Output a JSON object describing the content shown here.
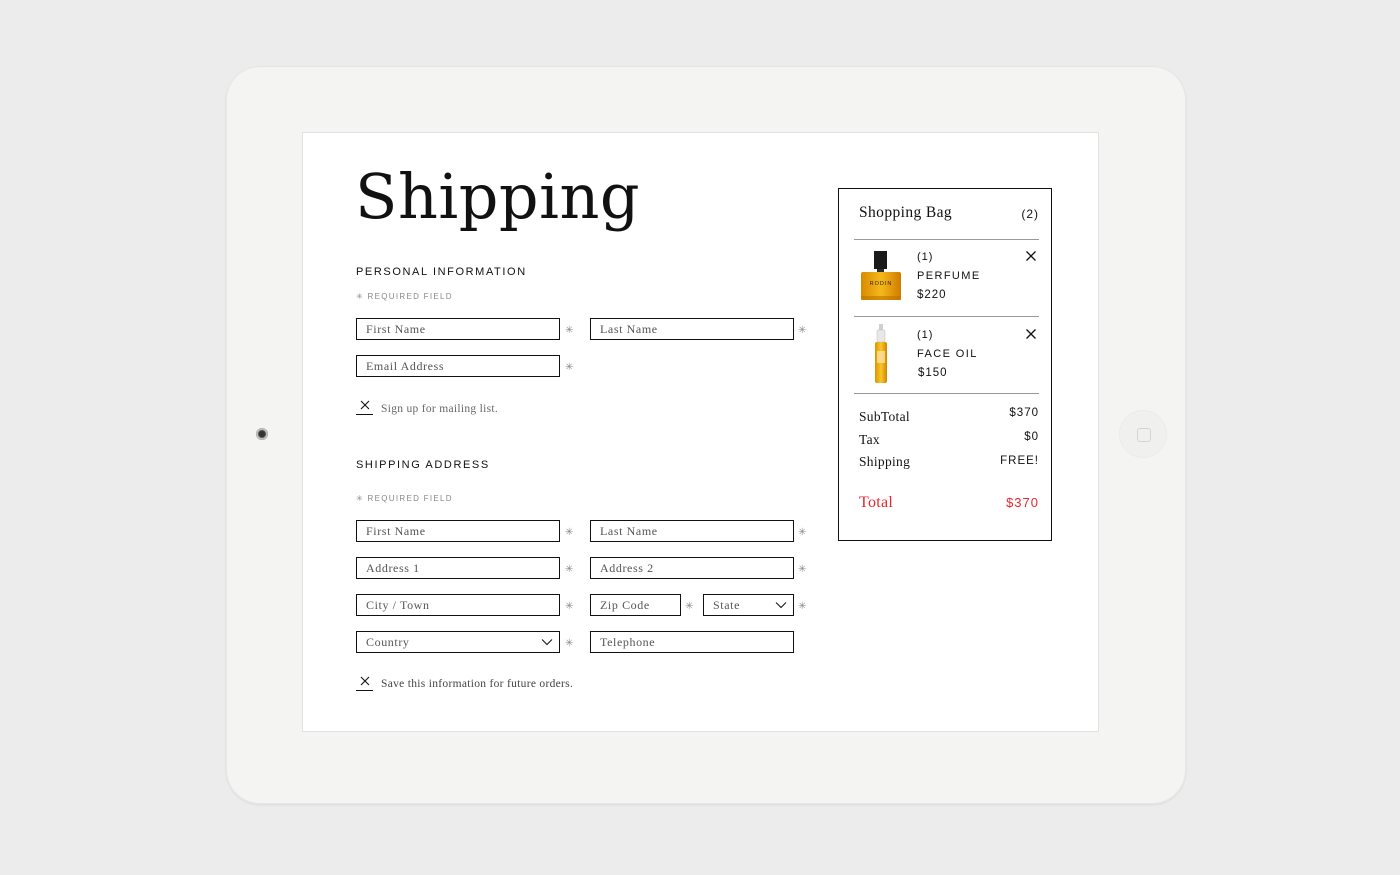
{
  "shipping": {
    "title": "Shipping",
    "personal": {
      "heading": "PERSONAL INFORMATION",
      "required_note": "✳ REQUIRED FIELD",
      "first_name_placeholder": "First Name",
      "last_name_placeholder": "Last Name",
      "email_placeholder": "Email Address",
      "mailing_label": "Sign up for mailing list."
    },
    "address": {
      "heading": "SHIPPING ADDRESS",
      "required_note": "✳ REQUIRED FIELD",
      "first_name_placeholder": "First Name",
      "last_name_placeholder": "Last Name",
      "address1_placeholder": "Address 1",
      "address2_placeholder": "Address 2",
      "city_placeholder": "City / Town",
      "zip_placeholder": "Zip Code",
      "state_value": "State",
      "country_value": "Country",
      "telephone_placeholder": "Telephone",
      "save_label": "Save this information for future orders."
    },
    "required_mark": "✳"
  },
  "bag": {
    "title": "Shopping Bag",
    "count": "(2)",
    "items": [
      {
        "qty": "(1)",
        "name": "PERFUME",
        "price": "$220",
        "label": "RODIN",
        "icon": "perfume-bottle-icon"
      },
      {
        "qty": "(1)",
        "name": "FACE OIL",
        "price": "$150",
        "icon": "face-oil-bottle-icon"
      }
    ],
    "summary": {
      "subtotal_label": "SubTotal",
      "subtotal_value": "$370",
      "tax_label": "Tax",
      "tax_value": "$0",
      "shipping_label": "Shipping",
      "shipping_value": "FREE!",
      "total_label": "Total",
      "total_value": "$370"
    }
  },
  "colors": {
    "accent_total": "#e8262f",
    "text": "#111111",
    "muted": "#888888",
    "device_frame": "#f4f4f3",
    "background": "#ececec"
  }
}
